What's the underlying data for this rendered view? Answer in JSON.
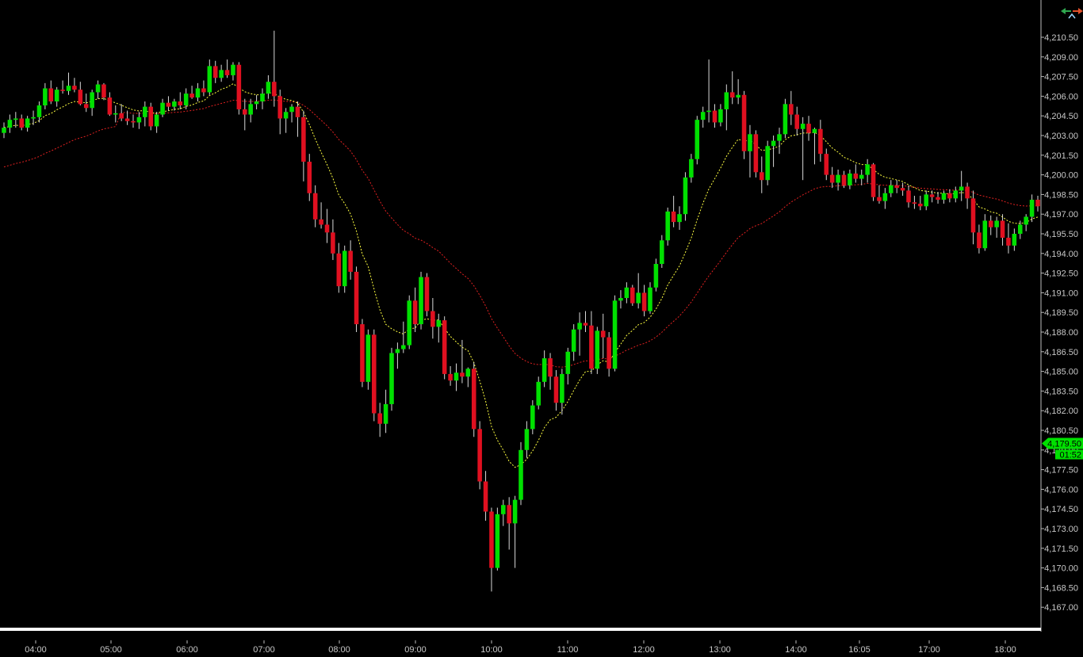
{
  "chart_data": {
    "type": "candlestick",
    "title": "",
    "xlabel": "",
    "ylabel": "",
    "ylim": [
      4166.0,
      4212.0
    ],
    "y_ticks": [
      "4,210.50",
      "4,209.00",
      "4,207.50",
      "4,206.00",
      "4,204.50",
      "4,203.00",
      "4,201.50",
      "4,200.00",
      "4,198.50",
      "4,197.00",
      "4,195.50",
      "4,194.00",
      "4,192.50",
      "4,191.00",
      "4,189.50",
      "4,188.00",
      "4,186.50",
      "4,185.00",
      "4,183.50",
      "4,182.00",
      "4,180.50",
      "4,179.00",
      "4,177.50",
      "4,176.00",
      "4,174.50",
      "4,173.00",
      "4,171.50",
      "4,170.00",
      "4,168.50",
      "4,167.00"
    ],
    "x_ticks": [
      "04:00",
      "05:00",
      "06:00",
      "07:00",
      "08:00",
      "09:00",
      "10:00",
      "11:00",
      "12:00",
      "13:00",
      "14:00",
      "16:05",
      "17:00",
      "18:00"
    ],
    "colors": {
      "up": "#00e000",
      "down": "#e01020",
      "fast_ma": "#ffff40",
      "slow_ma": "#e02020",
      "background": "#000000"
    },
    "last_price": "4,179.50",
    "countdown": "01:52",
    "candles": [
      [
        4203.2,
        4204.0,
        4202.8,
        4203.6
      ],
      [
        4203.6,
        4204.6,
        4203.2,
        4204.2
      ],
      [
        4204.2,
        4204.8,
        4203.6,
        4204.3
      ],
      [
        4204.3,
        4204.6,
        4203.4,
        4203.6
      ],
      [
        4203.6,
        4204.5,
        4203.3,
        4204.3
      ],
      [
        4204.3,
        4204.9,
        4203.8,
        4204.4
      ],
      [
        4204.4,
        4205.6,
        4204.0,
        4205.3
      ],
      [
        4205.3,
        4207.0,
        4205.0,
        4206.6
      ],
      [
        4206.6,
        4207.2,
        4205.4,
        4205.6
      ],
      [
        4205.6,
        4206.7,
        4205.2,
        4206.5
      ],
      [
        4206.5,
        4207.2,
        4206.2,
        4206.4
      ],
      [
        4206.4,
        4207.8,
        4206.1,
        4206.8
      ],
      [
        4206.8,
        4207.4,
        4206.3,
        4206.5
      ],
      [
        4206.5,
        4207.1,
        4205.3,
        4205.4
      ],
      [
        4205.4,
        4206.2,
        4204.8,
        4205.1
      ],
      [
        4205.1,
        4206.5,
        4204.5,
        4206.3
      ],
      [
        4206.3,
        4207.2,
        4205.8,
        4206.9
      ],
      [
        4206.9,
        4207.0,
        4205.7,
        4205.9
      ],
      [
        4205.9,
        4206.3,
        4204.5,
        4204.6
      ],
      [
        4204.6,
        4205.3,
        4204.0,
        4204.7
      ],
      [
        4204.7,
        4205.4,
        4204.1,
        4204.3
      ],
      [
        4204.3,
        4204.9,
        4203.8,
        4204.1
      ],
      [
        4204.1,
        4204.6,
        4203.6,
        4204.0
      ],
      [
        4204.0,
        4204.8,
        4203.5,
        4204.4
      ],
      [
        4204.4,
        4205.6,
        4203.7,
        4205.2
      ],
      [
        4205.2,
        4205.5,
        4203.4,
        4203.7
      ],
      [
        4203.7,
        4204.8,
        4203.2,
        4204.6
      ],
      [
        4204.6,
        4205.8,
        4204.4,
        4205.5
      ],
      [
        4205.5,
        4206.0,
        4204.9,
        4205.2
      ],
      [
        4205.2,
        4205.8,
        4204.9,
        4205.6
      ],
      [
        4205.6,
        4206.3,
        4205.0,
        4205.3
      ],
      [
        4205.3,
        4206.6,
        4205.0,
        4206.2
      ],
      [
        4206.2,
        4206.8,
        4205.8,
        4205.9
      ],
      [
        4205.9,
        4207.0,
        4205.6,
        4206.6
      ],
      [
        4206.6,
        4207.2,
        4206.0,
        4206.3
      ],
      [
        4206.3,
        4208.8,
        4206.1,
        4208.3
      ],
      [
        4208.3,
        4208.7,
        4207.0,
        4207.4
      ],
      [
        4207.4,
        4208.4,
        4207.1,
        4208.0
      ],
      [
        4208.0,
        4208.8,
        4207.4,
        4207.6
      ],
      [
        4207.6,
        4208.6,
        4207.2,
        4208.4
      ],
      [
        4208.4,
        4208.6,
        4204.6,
        4205.0
      ],
      [
        4205.0,
        4205.8,
        4203.4,
        4204.6
      ],
      [
        4204.6,
        4205.8,
        4204.0,
        4205.4
      ],
      [
        4205.4,
        4206.1,
        4205.0,
        4205.6
      ],
      [
        4205.6,
        4206.6,
        4205.0,
        4206.2
      ],
      [
        4206.2,
        4207.6,
        4205.8,
        4207.1
      ],
      [
        4207.1,
        4211.0,
        4205.2,
        4206.0
      ],
      [
        4206.0,
        4206.5,
        4203.1,
        4204.3
      ],
      [
        4204.3,
        4205.1,
        4203.2,
        4204.8
      ],
      [
        4204.8,
        4205.4,
        4204.0,
        4205.2
      ],
      [
        4205.2,
        4205.6,
        4202.9,
        4204.4
      ],
      [
        4204.4,
        4204.9,
        4199.5,
        4201.0
      ],
      [
        4201.0,
        4201.6,
        4198.0,
        4198.6
      ],
      [
        4198.6,
        4199.2,
        4196.0,
        4196.6
      ],
      [
        4196.6,
        4197.9,
        4195.9,
        4196.2
      ],
      [
        4196.2,
        4197.4,
        4194.8,
        4195.6
      ],
      [
        4195.6,
        4196.6,
        4193.5,
        4194.0
      ],
      [
        4194.0,
        4194.8,
        4191.0,
        4191.5
      ],
      [
        4191.5,
        4194.6,
        4191.0,
        4194.2
      ],
      [
        4194.2,
        4195.0,
        4192.0,
        4192.6
      ],
      [
        4192.6,
        4193.0,
        4188.0,
        4188.6
      ],
      [
        4188.6,
        4189.0,
        4183.8,
        4184.2
      ],
      [
        4184.2,
        4188.2,
        4183.6,
        4187.8
      ],
      [
        4187.8,
        4188.2,
        4181.2,
        4181.8
      ],
      [
        4181.8,
        4182.6,
        4180.0,
        4181.0
      ],
      [
        4181.0,
        4183.6,
        4180.3,
        4182.5
      ],
      [
        4182.5,
        4186.8,
        4182.0,
        4186.4
      ],
      [
        4186.4,
        4187.2,
        4185.2,
        4186.7
      ],
      [
        4186.7,
        4188.8,
        4186.4,
        4187.0
      ],
      [
        4187.0,
        4190.8,
        4186.7,
        4190.4
      ],
      [
        4190.4,
        4191.4,
        4188.0,
        4188.6
      ],
      [
        4188.6,
        4192.6,
        4188.2,
        4192.2
      ],
      [
        4192.2,
        4192.5,
        4189.2,
        4189.6
      ],
      [
        4189.6,
        4190.6,
        4187.5,
        4188.4
      ],
      [
        4188.4,
        4189.4,
        4187.2,
        4188.9
      ],
      [
        4188.9,
        4189.2,
        4184.4,
        4184.8
      ],
      [
        4184.8,
        4185.4,
        4183.9,
        4184.3
      ],
      [
        4184.3,
        4185.6,
        4183.5,
        4184.9
      ],
      [
        4184.9,
        4187.4,
        4184.1,
        4184.6
      ],
      [
        4184.6,
        4185.3,
        4183.8,
        4185.2
      ],
      [
        4185.2,
        4185.7,
        4180.0,
        4180.6
      ],
      [
        4180.6,
        4181.2,
        4176.0,
        4176.6
      ],
      [
        4176.6,
        4177.4,
        4173.6,
        4174.3
      ],
      [
        4174.3,
        4174.6,
        4168.2,
        4170.0
      ],
      [
        4170.0,
        4174.6,
        4169.8,
        4174.1
      ],
      [
        4174.1,
        4175.2,
        4173.2,
        4174.8
      ],
      [
        4174.8,
        4175.4,
        4171.4,
        4173.4
      ],
      [
        4173.4,
        4175.5,
        4170.0,
        4175.2
      ],
      [
        4175.2,
        4179.6,
        4174.8,
        4179.0
      ],
      [
        4179.0,
        4181.2,
        4178.4,
        4180.6
      ],
      [
        4180.6,
        4182.8,
        4180.2,
        4182.4
      ],
      [
        4182.4,
        4184.6,
        4182.1,
        4184.2
      ],
      [
        4184.2,
        4186.6,
        4183.8,
        4186.0
      ],
      [
        4186.0,
        4186.4,
        4183.6,
        4184.6
      ],
      [
        4184.6,
        4185.1,
        4182.0,
        4182.6
      ],
      [
        4182.6,
        4185.2,
        4181.7,
        4184.8
      ],
      [
        4184.8,
        4186.8,
        4184.0,
        4186.5
      ],
      [
        4186.5,
        4188.6,
        4185.8,
        4188.2
      ],
      [
        4188.2,
        4189.5,
        4186.2,
        4188.7
      ],
      [
        4188.7,
        4189.6,
        4188.0,
        4188.5
      ],
      [
        4188.5,
        4189.6,
        4184.8,
        4185.2
      ],
      [
        4185.2,
        4188.4,
        4184.8,
        4188.1
      ],
      [
        4188.1,
        4189.4,
        4186.0,
        4187.6
      ],
      [
        4187.6,
        4188.0,
        4184.6,
        4185.2
      ],
      [
        4185.2,
        4190.8,
        4185.0,
        4190.4
      ],
      [
        4190.4,
        4191.2,
        4189.8,
        4190.6
      ],
      [
        4190.6,
        4191.8,
        4190.2,
        4191.4
      ],
      [
        4191.4,
        4191.6,
        4190.0,
        4190.2
      ],
      [
        4190.2,
        4192.5,
        4189.8,
        4191.0
      ],
      [
        4191.0,
        4191.6,
        4189.2,
        4189.6
      ],
      [
        4189.6,
        4191.8,
        4189.4,
        4191.4
      ],
      [
        4191.4,
        4193.6,
        4191.1,
        4193.2
      ],
      [
        4193.2,
        4195.4,
        4192.9,
        4195.0
      ],
      [
        4195.0,
        4197.5,
        4194.6,
        4197.2
      ],
      [
        4197.2,
        4198.4,
        4196.0,
        4196.4
      ],
      [
        4196.4,
        4197.6,
        4195.8,
        4197.0
      ],
      [
        4197.0,
        4200.2,
        4196.5,
        4199.8
      ],
      [
        4199.8,
        4201.6,
        4199.4,
        4201.2
      ],
      [
        4201.2,
        4204.5,
        4200.8,
        4204.2
      ],
      [
        4204.2,
        4205.2,
        4203.6,
        4204.8
      ],
      [
        4204.8,
        4208.8,
        4204.0,
        4204.9
      ],
      [
        4204.9,
        4205.4,
        4203.6,
        4204.0
      ],
      [
        4204.0,
        4205.4,
        4203.7,
        4205.0
      ],
      [
        4205.0,
        4206.9,
        4203.4,
        4206.3
      ],
      [
        4206.3,
        4207.9,
        4205.4,
        4205.9
      ],
      [
        4205.9,
        4207.3,
        4205.4,
        4206.1
      ],
      [
        4206.1,
        4206.4,
        4201.2,
        4201.8
      ],
      [
        4201.8,
        4203.8,
        4199.8,
        4203.1
      ],
      [
        4203.1,
        4203.4,
        4199.8,
        4200.2
      ],
      [
        4200.2,
        4201.4,
        4198.6,
        4199.6
      ],
      [
        4199.6,
        4202.6,
        4199.2,
        4202.2
      ],
      [
        4202.2,
        4203.0,
        4200.6,
        4202.6
      ],
      [
        4202.6,
        4203.6,
        4201.6,
        4203.1
      ],
      [
        4203.1,
        4205.8,
        4202.8,
        4205.4
      ],
      [
        4205.4,
        4206.4,
        4203.8,
        4204.6
      ],
      [
        4204.6,
        4205.2,
        4203.0,
        4203.5
      ],
      [
        4203.5,
        4204.4,
        4199.6,
        4203.9
      ],
      [
        4203.9,
        4204.5,
        4202.6,
        4203.2
      ],
      [
        4203.2,
        4203.6,
        4200.8,
        4203.5
      ],
      [
        4203.5,
        4204.2,
        4201.0,
        4201.6
      ],
      [
        4201.6,
        4202.0,
        4199.6,
        4200.0
      ],
      [
        4200.0,
        4200.6,
        4199.0,
        4199.4
      ],
      [
        4199.4,
        4200.4,
        4198.8,
        4200.0
      ],
      [
        4200.0,
        4200.3,
        4199.0,
        4199.2
      ],
      [
        4199.2,
        4200.4,
        4198.9,
        4200.1
      ],
      [
        4200.1,
        4200.8,
        4199.4,
        4199.7
      ],
      [
        4199.7,
        4200.4,
        4199.2,
        4200.0
      ],
      [
        4200.0,
        4201.2,
        4199.4,
        4200.8
      ],
      [
        4200.8,
        4200.9,
        4198.0,
        4198.3
      ],
      [
        4198.3,
        4199.2,
        4197.8,
        4198.0
      ],
      [
        4198.0,
        4199.0,
        4197.4,
        4198.6
      ],
      [
        4198.6,
        4199.6,
        4198.3,
        4199.2
      ],
      [
        4199.2,
        4199.6,
        4198.6,
        4199.0
      ],
      [
        4199.0,
        4199.4,
        4198.4,
        4198.8
      ],
      [
        4198.8,
        4199.2,
        4197.5,
        4197.9
      ],
      [
        4197.9,
        4198.4,
        4197.4,
        4197.8
      ],
      [
        4197.8,
        4198.4,
        4197.3,
        4197.6
      ],
      [
        4197.6,
        4198.8,
        4197.3,
        4198.5
      ],
      [
        4198.5,
        4198.8,
        4197.9,
        4198.3
      ],
      [
        4198.3,
        4198.7,
        4197.8,
        4198.1
      ],
      [
        4198.1,
        4198.8,
        4197.8,
        4198.6
      ],
      [
        4198.6,
        4198.9,
        4197.9,
        4198.2
      ],
      [
        4198.2,
        4199.1,
        4197.9,
        4198.8
      ],
      [
        4198.8,
        4200.3,
        4198.0,
        4199.1
      ],
      [
        4199.1,
        4199.4,
        4197.4,
        4198.2
      ],
      [
        4198.2,
        4198.8,
        4194.7,
        4195.6
      ],
      [
        4195.6,
        4196.2,
        4194.0,
        4194.4
      ],
      [
        4194.4,
        4197.0,
        4194.2,
        4196.5
      ],
      [
        4196.5,
        4196.9,
        4195.4,
        4196.0
      ],
      [
        4196.0,
        4196.8,
        4195.2,
        4196.5
      ],
      [
        4196.5,
        4197.0,
        4194.6,
        4195.2
      ],
      [
        4195.2,
        4196.3,
        4194.0,
        4194.6
      ],
      [
        4194.6,
        4195.9,
        4194.2,
        4195.5
      ],
      [
        4195.5,
        4196.5,
        4195.1,
        4196.2
      ],
      [
        4196.2,
        4197.0,
        4195.7,
        4196.8
      ],
      [
        4196.8,
        4198.5,
        4196.4,
        4198.1
      ],
      [
        4198.1,
        4198.4,
        4197.2,
        4197.6
      ]
    ]
  }
}
